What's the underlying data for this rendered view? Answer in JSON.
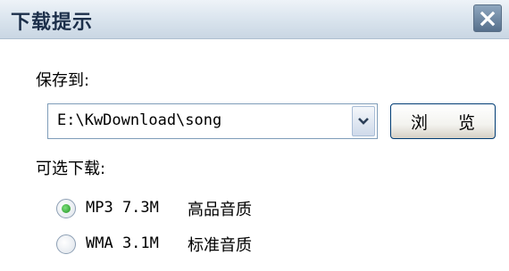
{
  "dialog": {
    "title": "下载提示"
  },
  "save_to": {
    "label": "保存到:",
    "path": "E:\\KwDownload\\song",
    "browse_label": "浏 览"
  },
  "download_options": {
    "label": "可选下载:",
    "options": [
      {
        "format": "MP3 7.3M",
        "quality": "高品音质",
        "selected": true
      },
      {
        "format": "WMA 3.1M",
        "quality": "标准音质",
        "selected": false
      }
    ]
  },
  "icons": {
    "close": "close-icon",
    "dropdown": "chevron-down-icon"
  },
  "colors": {
    "title_bar": "#dce6ef",
    "radio_selected": "#1f8f1f"
  }
}
